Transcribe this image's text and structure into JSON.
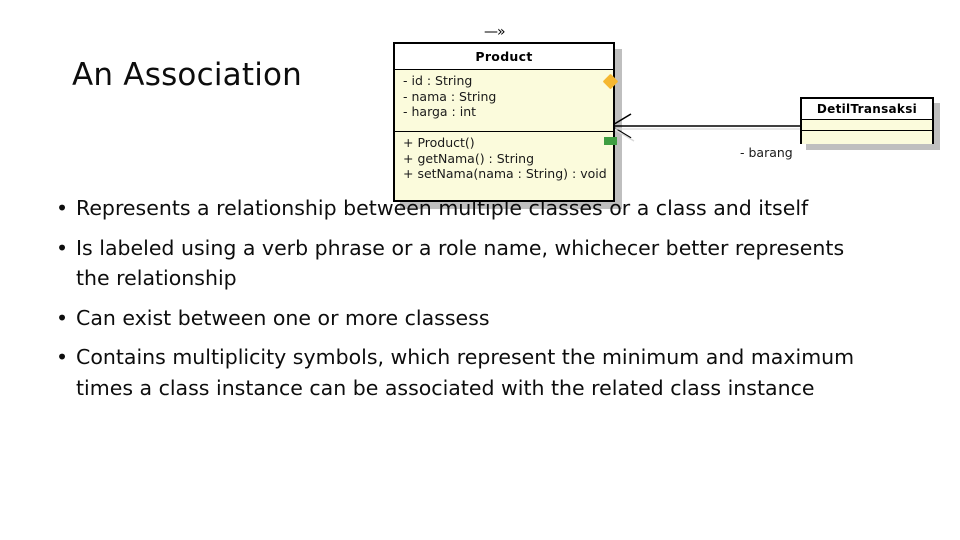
{
  "slide": {
    "title": "An Association"
  },
  "diagram": {
    "stereotype_mark": "—»",
    "classes": [
      {
        "name": "Product",
        "attributes": [
          "- id : String",
          "- nama : String",
          "- harga : int"
        ],
        "methods": [
          "+ Product()",
          "+ getNama() : String",
          "+ setNama(nama : String) : void"
        ]
      },
      {
        "name": "DetilTransaksi",
        "attributes": [],
        "methods": []
      }
    ],
    "role_label": "- barang",
    "colors": {
      "class_fill": "#fbfbdc",
      "class_title_fill": "#ffffff",
      "class_border": "#000000",
      "shadow": "#bfbfbf",
      "handle_orange": "#f5b731",
      "handle_green": "#3f9e42"
    }
  },
  "bullets": [
    "Represents a relationship between multiple classes or a class and itself",
    "Is labeled using a verb phrase or a role name, whichecer better represents the relationship",
    "Can exist between one or more classess",
    "Contains multiplicity symbols, which represent the minimum and maximum times a class instance can be associated with the related class instance"
  ]
}
